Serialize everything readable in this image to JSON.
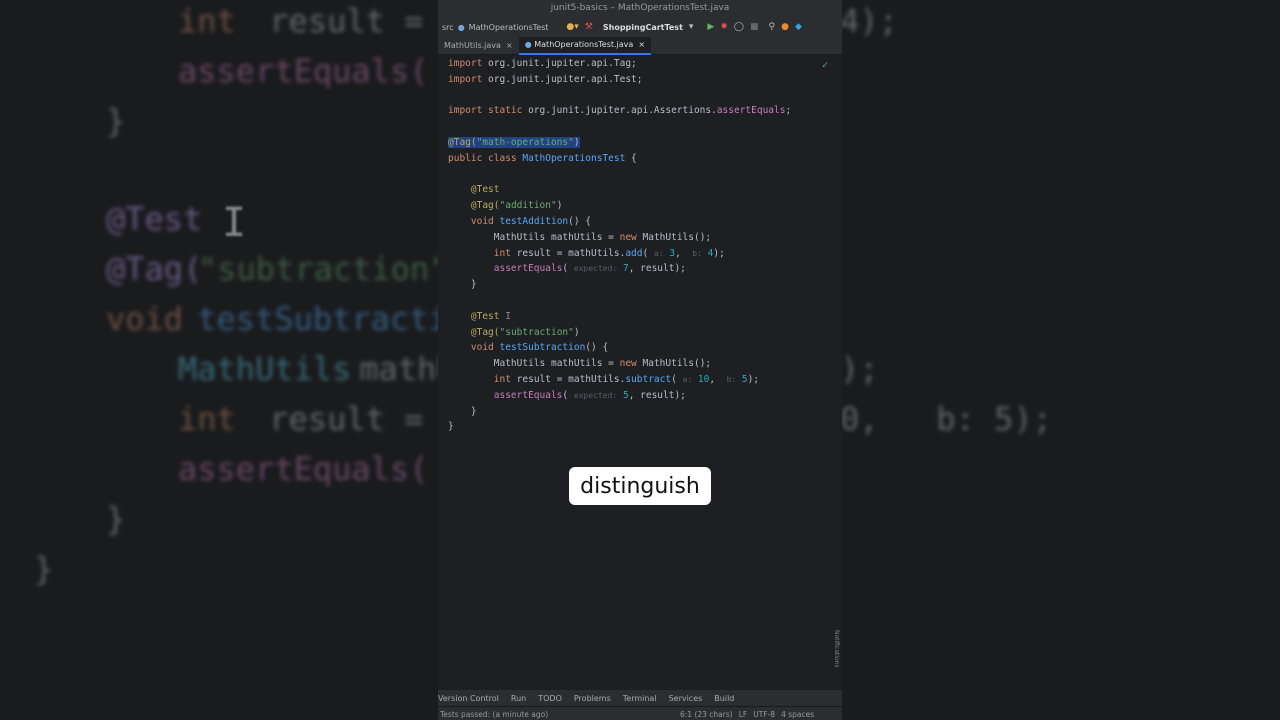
{
  "window": {
    "title": "junit5-basics – MathOperationsTest.java"
  },
  "toolbar": {
    "breadcrumb_src": "src",
    "breadcrumb_file": "MathOperationsTest",
    "run_config": "ShoppingCartTest"
  },
  "tabs": [
    {
      "label": "MathUtils.java"
    },
    {
      "label": "MathOperationsTest.java"
    }
  ],
  "code": {
    "l1_kw": "import",
    "l1_rest": " org.junit.jupiter.api.Tag;",
    "l2_kw": "import",
    "l2_rest": " org.junit.jupiter.api.Test;",
    "l4_kw": "import static",
    "l4_pkg": " org.junit.jupiter.api.Assertions.",
    "l4_fn": "assertEquals",
    "l4_end": ";",
    "l6_ann": "@Tag(",
    "l6_str": "\"math-operations\"",
    "l6_end": ")",
    "l7_kw": "public class",
    "l7_cls": " MathOperationsTest",
    "l7_end": " {",
    "test_ann": "@Test",
    "tag_ann": "@Tag(",
    "tag_add": "\"addition\"",
    "tag_sub": "\"subtraction\"",
    "close_paren": ")",
    "void_kw": "void",
    "fn_add": " testAddition",
    "fn_sub": " testSubtraction",
    "sig_end": "() {",
    "mu_type": "MathUtils",
    "mu_var": " mathUtils = ",
    "new_kw": "new",
    "mu_ctor": " MathUtils",
    "mu_end": "();",
    "int_kw": "int",
    "res_add": " result = mathUtils.",
    "add_fn": "add",
    "sub_fn": "subtract",
    "hint_a": "a:",
    "hint_b": "b:",
    "hint_expected": "expected:",
    "add_a": " 3",
    "add_b": " 4",
    "sub_a": " 10",
    "sub_b": " 5",
    "paren_open": "(",
    "comma": ",",
    "call_end": ");",
    "assert_fn": "assertEquals",
    "exp_add": " 7",
    "exp_sub": " 5",
    "assert_rest": ", result);",
    "brace_close": "}"
  },
  "bottom_tools": [
    "Version Control",
    "Run",
    "TODO",
    "Problems",
    "Terminal",
    "Services",
    "Build"
  ],
  "status": {
    "left": "Tests passed: (a minute ago)",
    "pos": "6:1 (23 chars)",
    "lf": "LF",
    "enc": "UTF-8",
    "indent": "4 spaces"
  },
  "notifications_label": "Notifications",
  "caption": "distinguish",
  "bg": {
    "l_int": "int",
    "l_result": " result = ma",
    "l_assert": "assertEquals(",
    "l_brace": "}",
    "l_test": "@Test",
    "l_tag": "@Tag(",
    "l_sub": "\"subtraction\"",
    "l_void": "void",
    "l_tsub": " testSubtractio",
    "l_mu": "MathUtils",
    "l_math": " mathU",
    "r_l1": "4);",
    "r_l2": ");",
    "r_l3": "0,   b: 5);"
  }
}
